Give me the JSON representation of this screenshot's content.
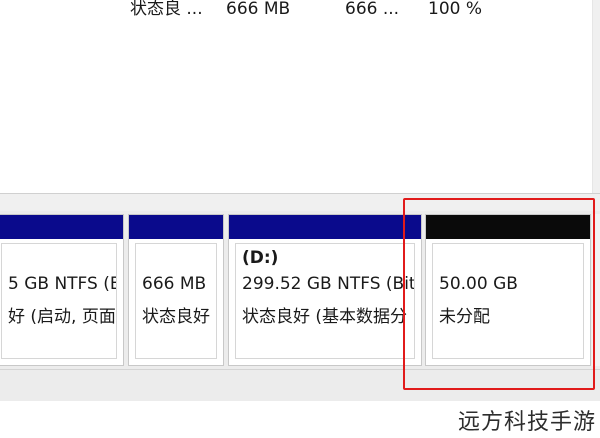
{
  "volume_list": {
    "row": {
      "status": "状态良 ...",
      "capacity": "666 MB",
      "free": "666 ...",
      "percent_free": "100 %"
    }
  },
  "disk": {
    "partitions": [
      {
        "label": "",
        "size": "5 GB NTFS (B",
        "status": "好 (启动, 页面",
        "bar_color": "#0a0a8c"
      },
      {
        "label": "",
        "size": "666 MB",
        "status": "状态良好",
        "bar_color": "#0a0a8c"
      },
      {
        "label": "(D:)",
        "size": "299.52 GB NTFS (Bit",
        "status": "状态良好 (基本数据分",
        "bar_color": "#0a0a8c"
      },
      {
        "label": "",
        "size": "50.00 GB",
        "status": "未分配",
        "bar_color": "#0a0a0a"
      }
    ]
  },
  "highlight_color": "#e11b1b",
  "watermark": "远方科技手游"
}
